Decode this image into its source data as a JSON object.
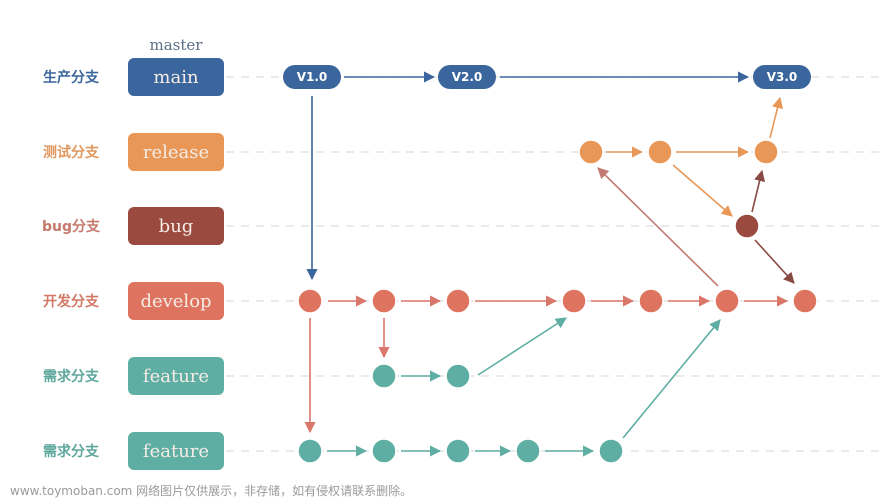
{
  "header": {
    "master_caption": "master"
  },
  "colors": {
    "main": "#3b669d",
    "release": "#e99756",
    "bug": "#9a4a3e",
    "develop": "#de7460",
    "feature": "#5eaea3",
    "grid": "#dddddd"
  },
  "lanes": [
    {
      "id": "main",
      "label": "生产分支",
      "branch": "main",
      "color": "#3b669d"
    },
    {
      "id": "release",
      "label": "测试分支",
      "branch": "release",
      "color": "#e99756"
    },
    {
      "id": "bug",
      "label": "bug分支",
      "branch": "bug",
      "color": "#9a4a3e"
    },
    {
      "id": "develop",
      "label": "开发分支",
      "branch": "develop",
      "color": "#de7460"
    },
    {
      "id": "feature1",
      "label": "需求分支",
      "branch": "feature",
      "color": "#5eaea3"
    },
    {
      "id": "feature2",
      "label": "需求分支",
      "branch": "feature",
      "color": "#5eaea3"
    }
  ],
  "tags": [
    {
      "id": "v1",
      "label": "V1.0"
    },
    {
      "id": "v2",
      "label": "V2.0"
    },
    {
      "id": "v3",
      "label": "V3.0"
    }
  ],
  "watermark": "www.toymoban.com 网络图片仅供展示，非存储，如有侵权请联系删除。"
}
